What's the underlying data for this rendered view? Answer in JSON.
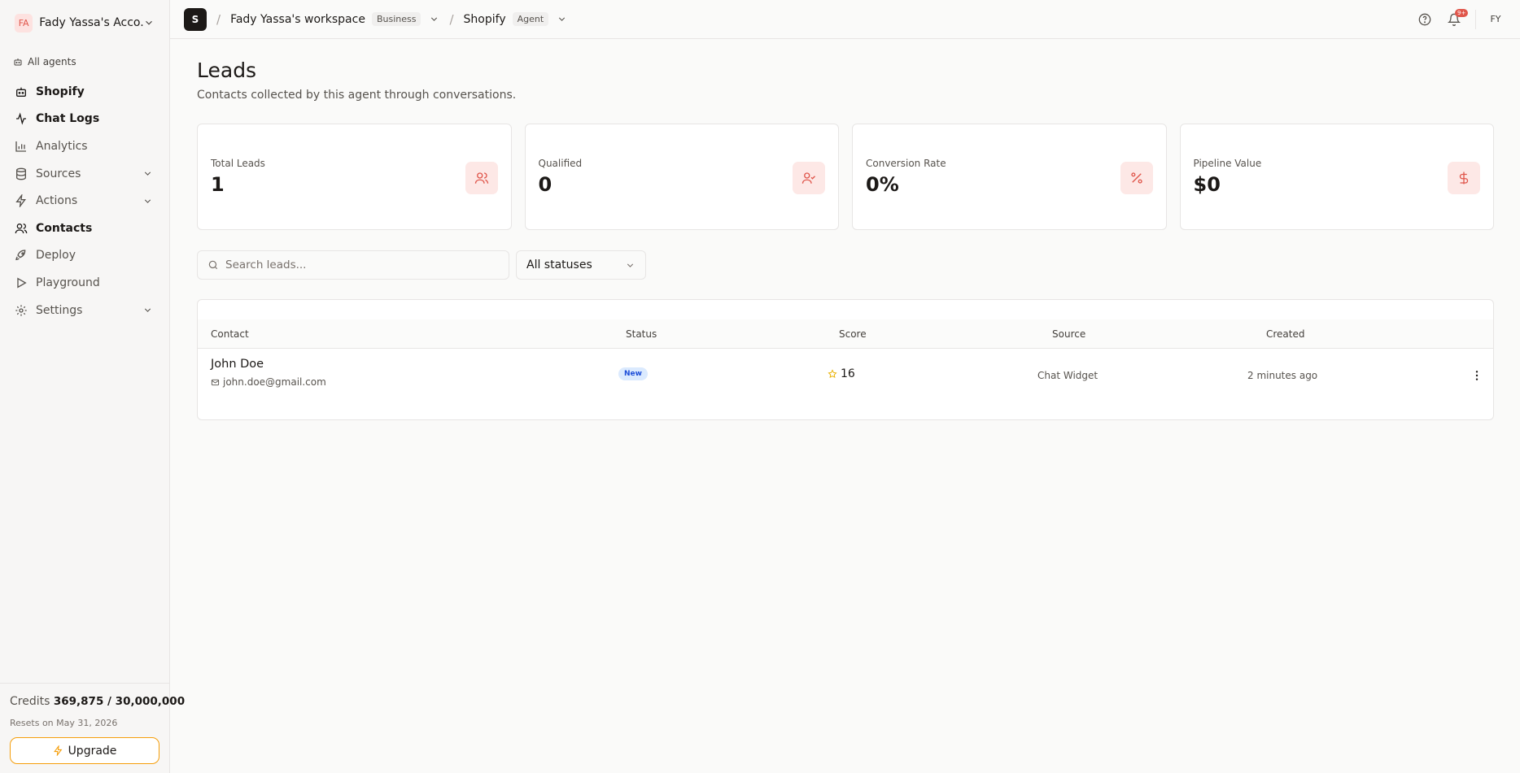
{
  "sidebar": {
    "account_initials": "FA",
    "account_name": "Fady Yassa's Acco...",
    "all_agents": "All agents",
    "items": [
      {
        "label": "Shopify"
      },
      {
        "label": "Chat Logs"
      },
      {
        "label": "Analytics"
      },
      {
        "label": "Sources"
      },
      {
        "label": "Actions"
      },
      {
        "label": "Contacts"
      },
      {
        "label": "Deploy"
      },
      {
        "label": "Playground"
      },
      {
        "label": "Settings"
      }
    ],
    "credits_label": "Credits",
    "credits_value": "369,875 / 30,000,000",
    "resets": "Resets on May 31, 2026",
    "upgrade": "Upgrade"
  },
  "topbar": {
    "workspace_initial": "S",
    "workspace": "Fady Yassa's workspace",
    "workspace_plan": "Business",
    "agent": "Shopify",
    "agent_tag": "Agent",
    "notif_count": "9+",
    "user_initials": "FY"
  },
  "page": {
    "title": "Leads",
    "subtitle": "Contacts collected by this agent through conversations."
  },
  "stats": [
    {
      "label": "Total Leads",
      "value": "1",
      "icon": "users-icon"
    },
    {
      "label": "Qualified",
      "value": "0",
      "icon": "user-check-icon"
    },
    {
      "label": "Conversion Rate",
      "value": "0%",
      "icon": "percent-icon"
    },
    {
      "label": "Pipeline Value",
      "value": "$0",
      "icon": "dollar-icon"
    }
  ],
  "filters": {
    "search_placeholder": "Search leads...",
    "status_selected": "All statuses"
  },
  "table": {
    "columns": [
      "Contact",
      "Status",
      "Score",
      "Source",
      "Created"
    ],
    "rows": [
      {
        "name": "John Doe",
        "email": "john.doe@gmail.com",
        "status": "New",
        "score": "16",
        "source": "Chat Widget",
        "created": "2 minutes ago"
      }
    ]
  },
  "colors": {
    "accent": "#e0564b",
    "accent_bg": "#fde8e6",
    "upgrade_border": "#f59e0b",
    "status_new_bg": "#dbeafe",
    "status_new_text": "#1d4ed8"
  }
}
